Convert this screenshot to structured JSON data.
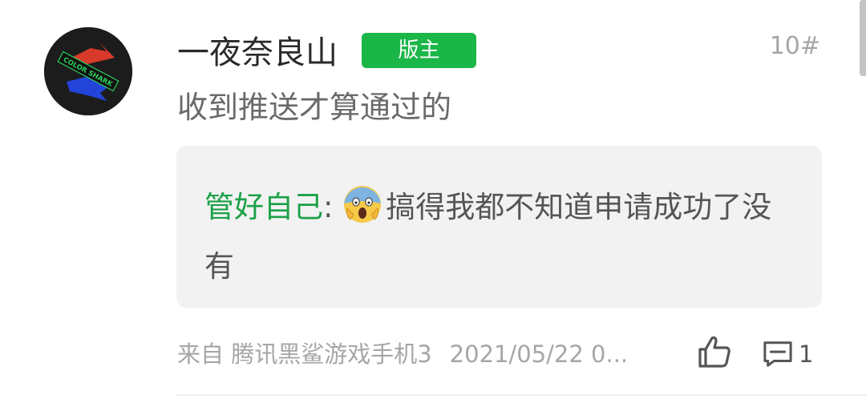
{
  "post": {
    "username": "一夜奈良山",
    "badge": "版主",
    "floor": "10#",
    "content": "收到推送才算通过的",
    "quote": {
      "author": "管好自己",
      "separator": ": ",
      "emoji": "screaming-face",
      "text": "搞得我都不知道申请成功了没有"
    },
    "meta": {
      "source": "来自 腾讯黑鲨游戏手机3",
      "time": "2021/05/22 0..."
    },
    "actions": {
      "like_icon": "thumbs-up-icon",
      "comment_icon": "comment-icon",
      "comment_count": "1"
    },
    "avatar_text": "COLOR SHARK"
  },
  "colors": {
    "badge": "#1ab647",
    "quote_author": "#1ba147",
    "quote_bg": "#f2f2f3",
    "muted": "#a6a6a6"
  }
}
